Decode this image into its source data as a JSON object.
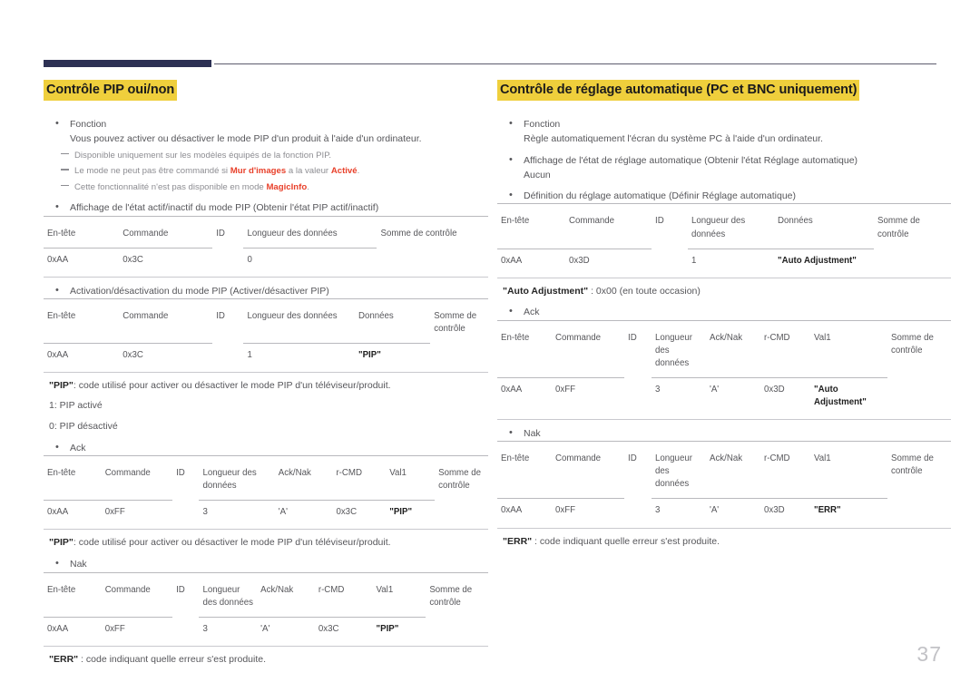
{
  "page": {
    "number": "37"
  },
  "left": {
    "title": "Contrôle PIP oui/non",
    "fonction_label": "Fonction",
    "fonction_text": "Vous pouvez activer ou désactiver le mode PIP d'un produit à l'aide d'un ordinateur.",
    "note1": "Disponible uniquement sur les modèles équipés de la fonction PIP.",
    "note2_a": "Le mode ne peut pas être commandé si ",
    "note2_b": "Mur d'images",
    "note2_c": " a la valeur ",
    "note2_d": "Activé",
    "note2_e": ".",
    "note3_a": "Cette fonctionnalité n'est pas disponible en mode ",
    "note3_b": "MagicInfo",
    "note3_c": ".",
    "bullet_get": "Affichage de l'état actif/inactif du mode PIP (Obtenir l'état PIP actif/inactif)",
    "table_get": {
      "headers": [
        "En-tête",
        "Commande",
        "ID",
        "Longueur des données",
        "Somme de contrôle"
      ],
      "values": [
        "0xAA",
        "0x3C",
        "",
        "0",
        ""
      ]
    },
    "bullet_set": "Activation/désactivation du mode PIP (Activer/désactiver PIP)",
    "table_set": {
      "headers": [
        "En-tête",
        "Commande",
        "ID",
        "Longueur des données",
        "Données",
        "Somme de contrôle"
      ],
      "values": [
        "0xAA",
        "0x3C",
        "",
        "1",
        "\"PIP\"",
        ""
      ]
    },
    "pip_desc_bold": "\"PIP\"",
    "pip_desc_rest": ": code utilisé pour activer ou désactiver le mode PIP d'un téléviseur/produit.",
    "pip_on": "1: PIP activé",
    "pip_off": "0: PIP désactivé",
    "bullet_ack": "Ack",
    "table_ack": {
      "headers": [
        "En-tête",
        "Commande",
        "ID",
        "Longueur des données",
        "Ack/Nak",
        "r-CMD",
        "Val1",
        "Somme de contrôle"
      ],
      "values": [
        "0xAA",
        "0xFF",
        "",
        "3",
        "'A'",
        "0x3C",
        "\"PIP\"",
        ""
      ]
    },
    "pip_desc2_bold": "\"PIP\"",
    "pip_desc2_rest": ": code utilisé pour activer ou désactiver le mode PIP d'un téléviseur/produit.",
    "bullet_nak": "Nak",
    "table_nak": {
      "headers": [
        "En-tête",
        "Commande",
        "ID",
        "Longueur des données",
        "Ack/Nak",
        "r-CMD",
        "Val1",
        "Somme de contrôle"
      ],
      "values": [
        "0xAA",
        "0xFF",
        "",
        "3",
        "'A'",
        "0x3C",
        "\"PIP\"",
        ""
      ]
    },
    "err_bold": "\"ERR\"",
    "err_rest": " : code indiquant quelle erreur s'est produite."
  },
  "right": {
    "title": "Contrôle de réglage automatique (PC et BNC uniquement)",
    "fonction_label": "Fonction",
    "fonction_text": "Règle automatiquement l'écran du système PC à l'aide d'un ordinateur.",
    "bullet_get": "Affichage de l'état de réglage automatique (Obtenir l'état Réglage automatique)",
    "bullet_get_sub": "Aucun",
    "bullet_set": "Définition du réglage automatique (Définir Réglage automatique)",
    "table_set": {
      "headers": [
        "En-tête",
        "Commande",
        "ID",
        "Longueur des données",
        "Données",
        "Somme de contrôle"
      ],
      "values": [
        "0xAA",
        "0x3D",
        "",
        "1",
        "\"Auto Adjustment\"",
        ""
      ]
    },
    "auto_desc_bold": "\"Auto Adjustment\"",
    "auto_desc_rest": " : 0x00 (en toute occasion)",
    "bullet_ack": "Ack",
    "table_ack": {
      "headers": [
        "En-tête",
        "Commande",
        "ID",
        "Longueur des données",
        "Ack/Nak",
        "r-CMD",
        "Val1",
        "Somme de contrôle"
      ],
      "values": [
        "0xAA",
        "0xFF",
        "",
        "3",
        "'A'",
        "0x3D",
        "\"Auto Adjustment\"",
        ""
      ]
    },
    "bullet_nak": "Nak",
    "table_nak": {
      "headers": [
        "En-tête",
        "Commande",
        "ID",
        "Longueur des données",
        "Ack/Nak",
        "r-CMD",
        "Val1",
        "Somme de contrôle"
      ],
      "values": [
        "0xAA",
        "0xFF",
        "",
        "3",
        "'A'",
        "0x3D",
        "\"ERR\"",
        ""
      ]
    },
    "err_bold": "\"ERR\"",
    "err_rest": " : code indiquant quelle erreur s'est produite."
  },
  "colors": {
    "accent_bar": "#2d3154",
    "highlight": "#efcf3c",
    "emphasis_red": "#e8402a",
    "body_text": "#56565a",
    "page_number": "#c2c2c6"
  }
}
